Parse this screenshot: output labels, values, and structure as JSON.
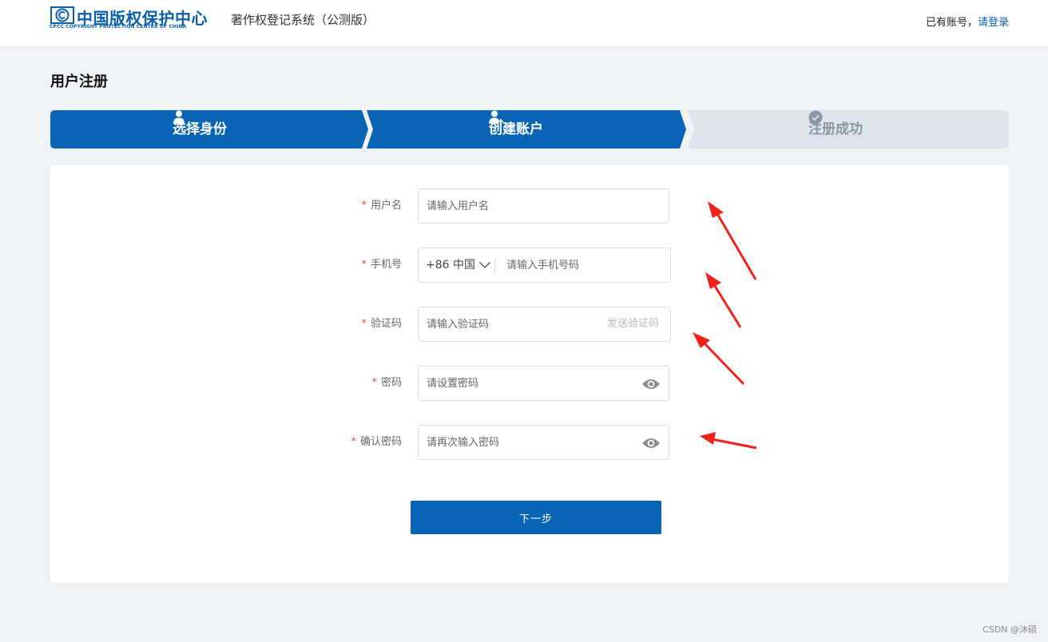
{
  "header": {
    "logo_cn": "中国版权保护中心",
    "logo_en": "CPCC COPYRIGHT PROTECTION CENTER OF CHINA",
    "system_title": "著作权登记系统（公测版）",
    "login_question": "已有账号，",
    "login_link": "请登录"
  },
  "page": {
    "title": "用户注册"
  },
  "steps": [
    {
      "label": "选择身份",
      "icon": "user-icon",
      "state": "done"
    },
    {
      "label": "创建账户",
      "icon": "user-add-icon",
      "state": "active"
    },
    {
      "label": "注册成功",
      "icon": "check-circle-icon",
      "state": "pending"
    }
  ],
  "form": {
    "username": {
      "label": "用户名",
      "placeholder": "请输入用户名",
      "value": ""
    },
    "phone": {
      "label": "手机号",
      "country_code": "+86 中国",
      "placeholder": "请输入手机号码",
      "value": ""
    },
    "code": {
      "label": "验证码",
      "placeholder": "请输入验证码",
      "send_label": "发送验证码",
      "value": ""
    },
    "password": {
      "label": "密码",
      "placeholder": "请设置密码",
      "value": ""
    },
    "confirm": {
      "label": "确认密码",
      "placeholder": "请再次输入密码",
      "value": ""
    },
    "required_mark": "*"
  },
  "actions": {
    "next_label": "下一步"
  },
  "watermark": "CSDN @沐硕",
  "colors": {
    "primary": "#0a64b5",
    "step_inactive_bg": "#dfe4ea",
    "required": "#e34a4a",
    "annotation_arrow": "#f0221a"
  }
}
